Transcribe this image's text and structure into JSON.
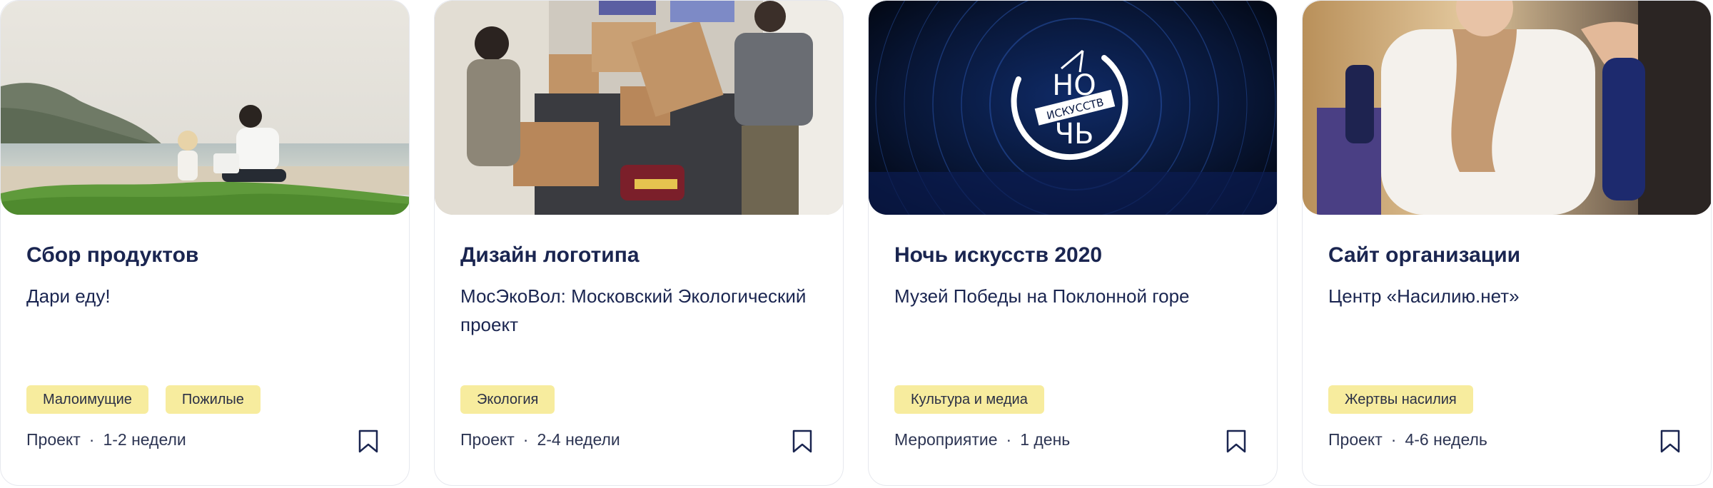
{
  "cards": [
    {
      "title": "Сбор продуктов",
      "organization": "Дари еду!",
      "tags": [
        "Малоимущие",
        "Пожилые"
      ],
      "type": "Проект",
      "duration": "1-2 недели",
      "photo_icon": "beach-people-photo"
    },
    {
      "title": "Дизайн логотипа",
      "organization": "МосЭкоВол: Московский Экологический проект",
      "tags": [
        "Экология"
      ],
      "type": "Проект",
      "duration": "2-4 недели",
      "photo_icon": "volunteers-boxes-photo"
    },
    {
      "title": "Ночь искусств 2020",
      "organization": "Музей Победы на Поклонной горе",
      "tags": [
        "Культура и медиа"
      ],
      "type": "Мероприятие",
      "duration": "1 день",
      "photo_icon": "night-of-arts-logo-photo",
      "logo_text": {
        "top": "НО",
        "middle": "ИСКУССТВ",
        "bottom": "ЧЬ"
      }
    },
    {
      "title": "Сайт организации",
      "organization": "Центр «Насилию.нет»",
      "tags": [
        "Жертвы насилия"
      ],
      "type": "Проект",
      "duration": "4-6 недель",
      "photo_icon": "wheelchair-woman-photo"
    }
  ],
  "meta_separator": "·",
  "colors": {
    "title": "#1a2550",
    "tag_background": "#f7ec9e",
    "card_border": "#e6e8ee"
  }
}
